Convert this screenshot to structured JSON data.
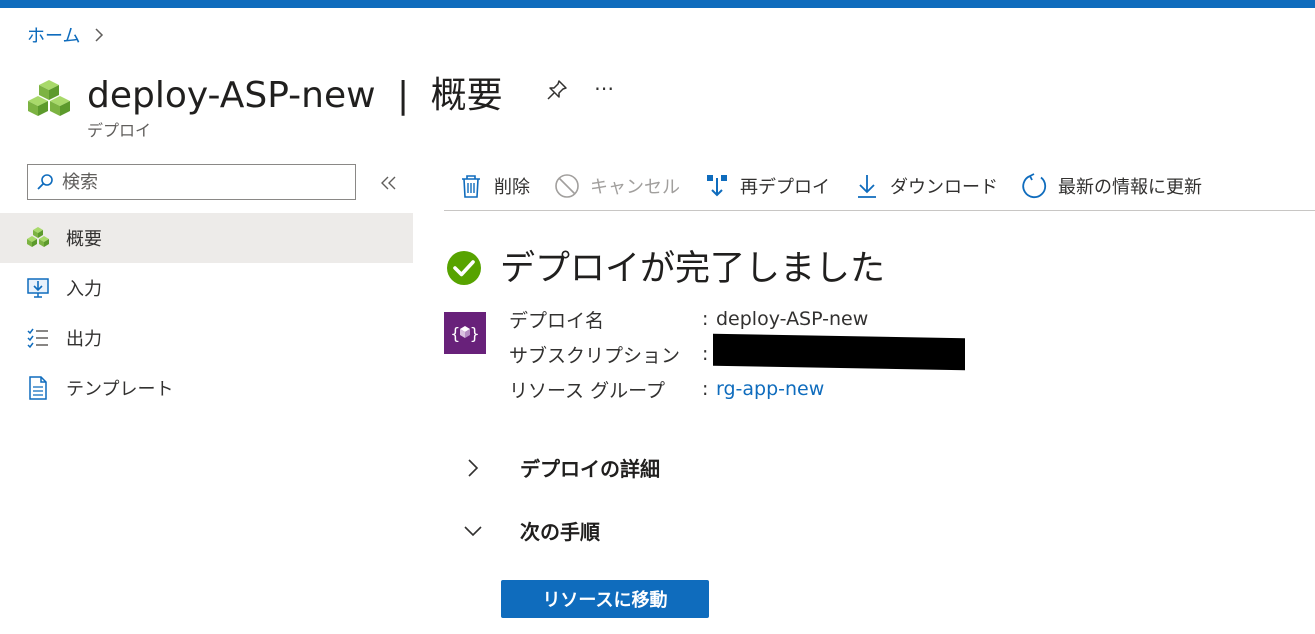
{
  "breadcrumb": {
    "home_label": "ホーム"
  },
  "header": {
    "resource_name": "deploy-ASP-new",
    "separator": "|",
    "page_name": "概要",
    "subtitle": "デプロイ",
    "more_label": "⋯"
  },
  "sidebar": {
    "search_placeholder": "検索",
    "collapse_label": "«",
    "items": [
      {
        "label": "概要",
        "icon": "cubes-icon",
        "active": true
      },
      {
        "label": "入力",
        "icon": "monitor-download-icon",
        "active": false
      },
      {
        "label": "出力",
        "icon": "checklist-icon",
        "active": false
      },
      {
        "label": "テンプレート",
        "icon": "document-icon",
        "active": false
      }
    ]
  },
  "toolbar": {
    "delete_label": "削除",
    "cancel_label": "キャンセル",
    "redeploy_label": "再デプロイ",
    "download_label": "ダウンロード",
    "refresh_label": "最新の情報に更新"
  },
  "status": {
    "title": "デプロイが完了しました",
    "color": "#57a300"
  },
  "details": {
    "name_label": "デプロイ名",
    "name_value": "deploy-ASP-new",
    "subscription_label": "サブスクリプション",
    "subscription_value": "",
    "resource_group_label": "リソース グループ",
    "resource_group_value": "rg-app-new",
    "separator": ":"
  },
  "sections": {
    "details_label": "デプロイの詳細",
    "next_steps_label": "次の手順"
  },
  "actions": {
    "go_to_resource_label": "リソースに移動"
  },
  "colors": {
    "accent": "#0f6cbd",
    "deploy_icon_bg": "#68217a"
  }
}
